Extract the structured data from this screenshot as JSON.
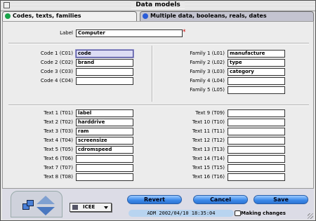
{
  "window": {
    "title": "Data models"
  },
  "tabs": [
    {
      "label": "Codes, texts, families",
      "dot_color": "#1aa34a",
      "active": true
    },
    {
      "label": "Multiple data, booleans, reals, dates",
      "dot_color": "#2a5cd8",
      "active": false
    }
  ],
  "label_field": {
    "label": "Label",
    "value": "Computer",
    "required_mark": "*"
  },
  "codes": [
    {
      "label": "Code 1 (C01)",
      "value": "code"
    },
    {
      "label": "Code 2 (C02)",
      "value": "brand"
    },
    {
      "label": "Code 3 (C03)",
      "value": ""
    },
    {
      "label": "Code 4 (C04)",
      "value": ""
    }
  ],
  "families": [
    {
      "label": "Family 1 (L01)",
      "value": "manufacture"
    },
    {
      "label": "Family 2 (L02)",
      "value": "type"
    },
    {
      "label": "Family 3 (L03)",
      "value": "category"
    },
    {
      "label": "Family 4 (L04)",
      "value": ""
    },
    {
      "label": "Family 5 (L05)",
      "value": ""
    }
  ],
  "texts_left": [
    {
      "label": "Text 1 (T01)",
      "value": "label"
    },
    {
      "label": "Text 2 (T02)",
      "value": "harddrive"
    },
    {
      "label": "Text 3 (T03)",
      "value": "ram"
    },
    {
      "label": "Text 4 (T04)",
      "value": "screensize"
    },
    {
      "label": "Text 5 (T05)",
      "value": "cdromspeed"
    },
    {
      "label": "Text 6 (T06)",
      "value": ""
    },
    {
      "label": "Text 7 (T07)",
      "value": ""
    },
    {
      "label": "Text 8 (T08)",
      "value": ""
    }
  ],
  "texts_right": [
    {
      "label": "Text 9 (T09)",
      "value": ""
    },
    {
      "label": "Text 10 (T10)",
      "value": ""
    },
    {
      "label": "Text 11 (T11)",
      "value": ""
    },
    {
      "label": "Text 12 (T12)",
      "value": ""
    },
    {
      "label": "Text 13 (T13)",
      "value": ""
    },
    {
      "label": "Text 14 (T14)",
      "value": ""
    },
    {
      "label": "Text 15 (T15)",
      "value": ""
    },
    {
      "label": "Text 16 (T16)",
      "value": ""
    }
  ],
  "footer": {
    "popup_value": "ICEE",
    "buttons": {
      "revert": "Revert",
      "cancel": "Cancel",
      "save": "Save"
    },
    "status_meta": "ADM  2002/04/10  18:35:04",
    "status_message": "Making changes"
  }
}
